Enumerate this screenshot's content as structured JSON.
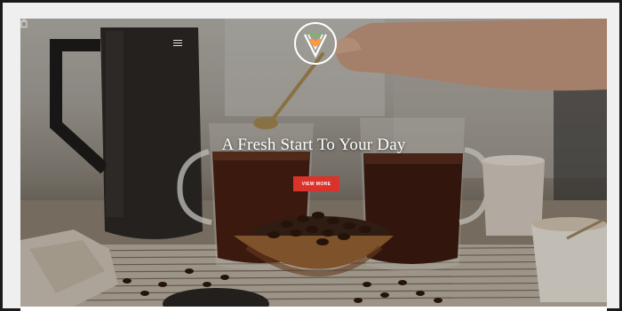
{
  "hero": {
    "headline": "A Fresh Start To Your Day",
    "cta_label": "VIEW MORE"
  },
  "icons": {
    "menu": "hamburger-menu-icon",
    "cart": "shopping-bag-icon",
    "logo": "heart-v-logo"
  },
  "colors": {
    "cta": "#d9332b",
    "frame": "#efefef",
    "border": "#1a1a1a",
    "text": "#ffffff"
  }
}
